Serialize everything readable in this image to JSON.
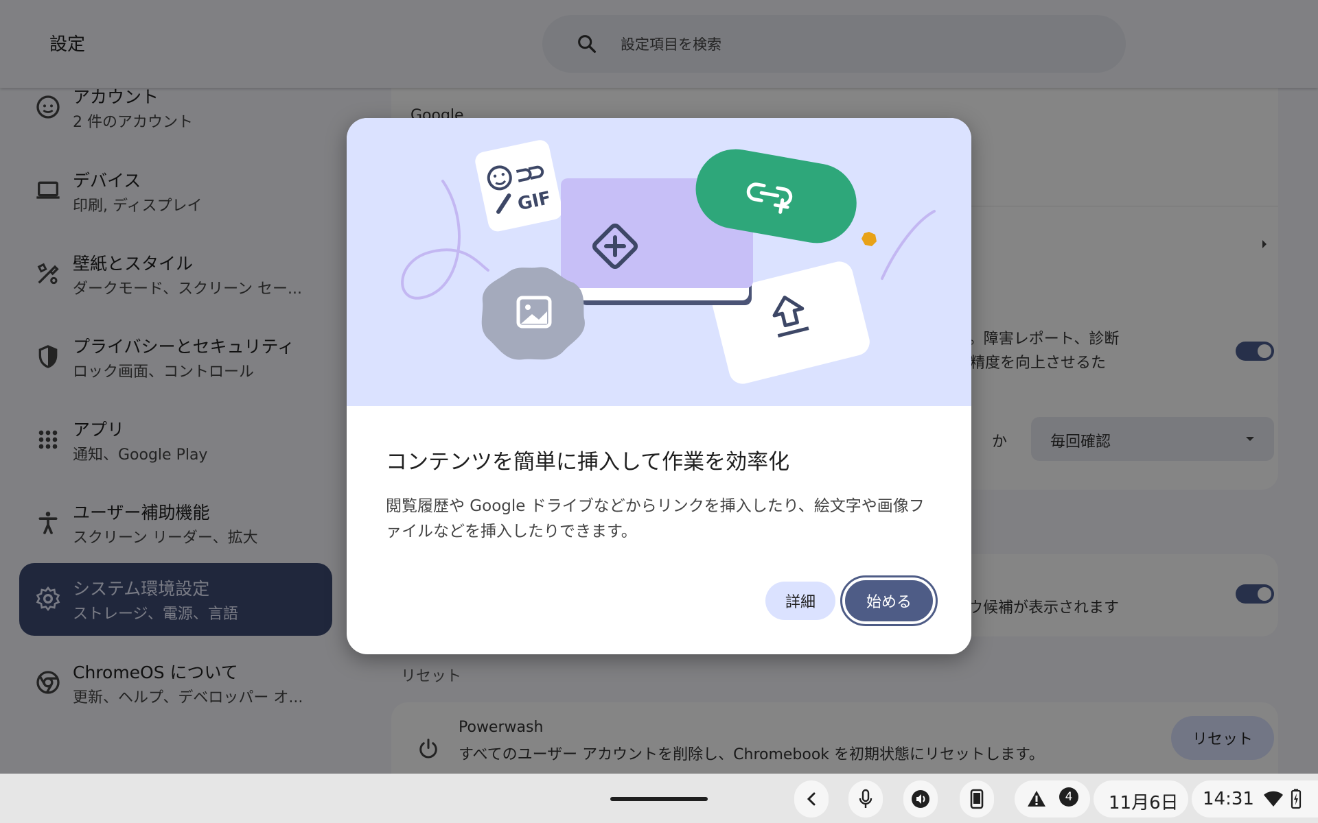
{
  "app": {
    "title": "設定",
    "search_placeholder": "設定項目を検索"
  },
  "sidebar": {
    "items": [
      {
        "title": "アカウント",
        "subtitle": "2 件のアカウント",
        "icon": "account-face-icon"
      },
      {
        "title": "デバイス",
        "subtitle": "印刷, ディスプレイ",
        "icon": "laptop-icon"
      },
      {
        "title": "壁紙とスタイル",
        "subtitle": "ダークモード、スクリーン セー...",
        "icon": "palette-icon"
      },
      {
        "title": "プライバシーとセキュリティ",
        "subtitle": "ロック画面、コントロール",
        "icon": "shield-icon"
      },
      {
        "title": "アプリ",
        "subtitle": "通知、Google Play",
        "icon": "apps-grid-icon"
      },
      {
        "title": "ユーザー補助機能",
        "subtitle": "スクリーン リーダー、拡大",
        "icon": "accessibility-icon"
      },
      {
        "title": "システム環境設定",
        "subtitle": "ストレージ、電源、言語",
        "icon": "gear-icon",
        "active": true
      },
      {
        "title": "ChromeOS について",
        "subtitle": "更新、ヘルプ、デベロッパー オ...",
        "icon": "chrome-icon"
      }
    ]
  },
  "main": {
    "google_label": "Google",
    "privacy_text_line1": "されます。障害レポート、診断",
    "privacy_text_line2": "、候補の精度を向上させるた",
    "dropdown_prefix": "か",
    "dropdown_value": "毎回確認",
    "suggestion_text": "ウ候補が表示されます",
    "reset_section_label": "リセット",
    "powerwash_title": "Powerwash",
    "powerwash_desc": "すべてのユーザー アカウントを削除し、Chromebook を初期状態にリセットします。",
    "reset_button": "リセット"
  },
  "dialog": {
    "title": "コンテンツを簡単に挿入して作業を効率化",
    "body": "閲覧履歴や Google ドライブなどからリンクを挿入したり、絵文字や画像ファイルなどを挿入したりできます。",
    "details_button": "詳細",
    "start_button": "始める",
    "illustration_text": "GIF",
    "colors": {
      "illustration_bg": "#dbe2ff",
      "purple_card": "#c7bff7",
      "green_pill": "#2ea77a",
      "primary_button": "#4e5c86"
    }
  },
  "shelf": {
    "notification_count": "4",
    "date": "11月6日",
    "time": "14:31"
  }
}
